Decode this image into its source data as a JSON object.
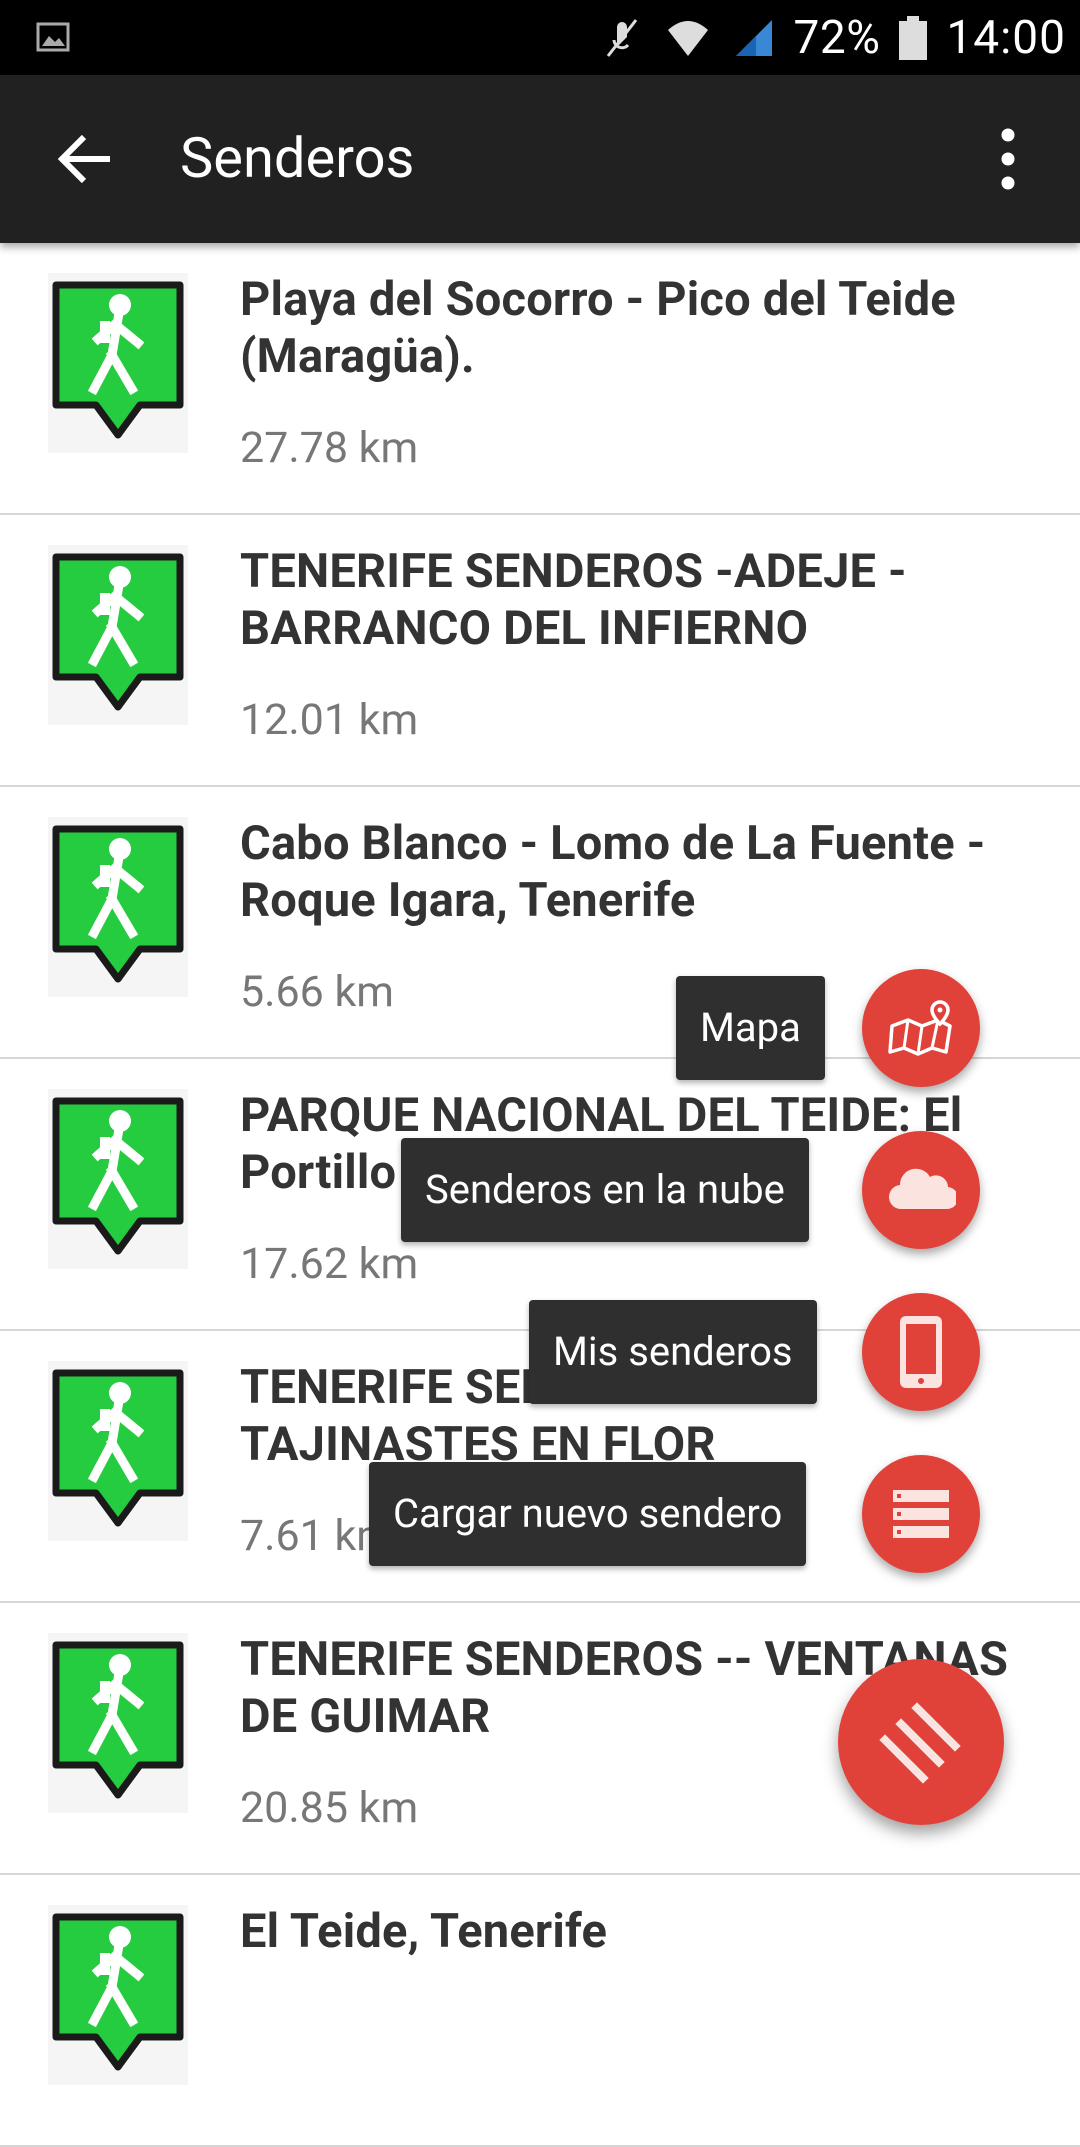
{
  "status_bar": {
    "battery_percent": "72%",
    "time": "14:00",
    "icons": [
      "image-icon",
      "mute-icon",
      "wifi-icon",
      "signal-icon",
      "battery-icon"
    ]
  },
  "app_bar": {
    "title": "Senderos",
    "back_icon": "arrow-back-icon",
    "menu_icon": "more-vert-icon"
  },
  "trails": [
    {
      "title": "Playa del Socorro - Pico del Teide (Maragüa).",
      "distance": "27.78 km"
    },
    {
      "title": "TENERIFE SENDEROS -ADEJE - BARRANCO DEL INFIERNO",
      "distance": "12.01 km"
    },
    {
      "title": "Cabo Blanco - Lomo de La Fuente - Roque Igara, Tenerife",
      "distance": "5.66 km"
    },
    {
      "title": "PARQUE NACIONAL DEL TEIDE: El Portillo",
      "distance": "17.62 km"
    },
    {
      "title": "TENERIFE SENDEROS",
      "title_line2": "TAJINASTES EN FLOR",
      "distance": "7.61 km"
    },
    {
      "title": "TENERIFE SENDEROS -- VENTANAS DE GUIMAR",
      "distance": "20.85 km"
    },
    {
      "title": "El Teide, Tenerife",
      "distance": ""
    }
  ],
  "speed_dial": {
    "actions": [
      {
        "label": "Mapa",
        "icon": "map-icon"
      },
      {
        "label": "Senderos en la nube",
        "icon": "cloud-icon"
      },
      {
        "label": "Mis senderos",
        "icon": "phone-icon"
      },
      {
        "label": "Cargar nuevo sendero",
        "icon": "list-icon"
      }
    ],
    "main_icon": "stripes-icon"
  },
  "colors": {
    "accent": "#e0423a",
    "app_bar": "#212121",
    "pin_green": "#22cc44"
  }
}
